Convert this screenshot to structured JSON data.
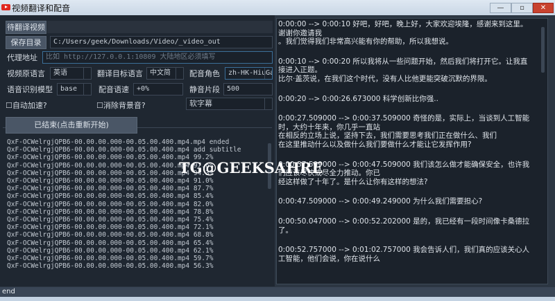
{
  "window": {
    "title": "视频翻译和配音",
    "minimize": "—",
    "maximize": "▫",
    "close": "✕"
  },
  "form": {
    "video_button": "待翻译视频",
    "video_path": "",
    "save_button": "保存目录",
    "save_path": "C:/Users/geek/Downloads/Video/_video_out",
    "proxy_label": "代理地址",
    "proxy_placeholder": "比如 http://127.0.0.1:10809 大陆地区必须填写",
    "source_lang_label": "视频原语言",
    "source_lang": "英语",
    "target_lang_label": "翻译目标语言",
    "target_lang": "中文简",
    "voice_label": "配音角色",
    "voice": "zh-HK-HiuGa",
    "model_label": "语音识别模型",
    "model": "base",
    "rate_label": "配音语速",
    "rate": "+0%",
    "silence_label": "静音片段",
    "silence": "500",
    "auto_speed_label": "自动加速?",
    "auto_speed": false,
    "remove_bg_label": "消除背景音?",
    "remove_bg": false,
    "subtitle_mode": "软字幕",
    "start_button": "已结束(点击重新开始)"
  },
  "log": [
    "QxF-OCWelrgjQPB6-00.00.00.000-00.05.00.400.mp4.mp4 ended",
    "QxF-OCWelrgjQPB6-00.00.00.000-00.05.00.400.mp4 add subtitle",
    "QxF-OCWelrgjQPB6-00.00.00.000-00.05.00.400.mp4 99.2%",
    "QxF-OCWelrgjQPB6-00.00.00.000-00.05.00.400.mp4 97.6%",
    "QxF-OCWelrgjQPB6-00.00.00.000-00.05.00.400.mp4 94.3%",
    "QxF-OCWelrgjQPB6-00.00.00.000-00.05.00.400.mp4 91.0%",
    "QxF-OCWelrgjQPB6-00.00.00.000-00.05.00.400.mp4 87.7%",
    "QxF-OCWelrgjQPB6-00.00.00.000-00.05.00.400.mp4 85.4%",
    "QxF-OCWelrgjQPB6-00.00.00.000-00.05.00.400.mp4 82.0%",
    "QxF-OCWelrgjQPB6-00.00.00.000-00.05.00.400.mp4 78.8%",
    "QxF-OCWelrgjQPB6-00.00.00.000-00.05.00.400.mp4 75.4%",
    "QxF-OCWelrgjQPB6-00.00.00.000-00.05.00.400.mp4 72.1%",
    "QxF-OCWelrgjQPB6-00.00.00.000-00.05.00.400.mp4 68.8%",
    "QxF-OCWelrgjQPB6-00.00.00.000-00.05.00.400.mp4 65.4%",
    "QxF-OCWelrgjQPB6-00.00.00.000-00.05.00.400.mp4 62.1%",
    "QxF-OCWelrgjQPB6-00.00.00.000-00.05.00.400.mp4 59.7%",
    "QxF-OCWelrgjQPB6-00.00.00.000-00.05.00.400.mp4 56.3%"
  ],
  "subtitles": [
    "0:00:00 --> 0:00:10 好吧，好吧，晚上好，大家欢迎埃隆，感谢来到这里。谢谢你邀请我\n。我们觉得我们非常高兴能有你的帮助，所以我想说。",
    "0:00:10 --> 0:00:20 所以我将从一些问题开始，然后我们将打开它。让我直接进入正题。\n比尔·盖茨说，在我们这个时代，没有人比他更能突破沉默的界限。",
    "0:00:20 --> 0:00:26.673000 科学创新比你强..",
    "0:00:27.509000 --> 0:00:37.509000 奇怪的是，实际上，当谈到人工智能时，大约十年来，你几乎一直站\n在相反的立场上说，坚持下去，我们需要思考我们正在做什么、我们\n在这里推动什么以及做什么我们要做什么才能让它发挥作用?",
    "0:00:37.509000 --> 0:00:47.509000 我们该怎么做才能确保安全，也许我们应该尽快或尽全力推动。你已\n经这样做了十年了。是什么让你有这样的想法?",
    "0:00:47.509000 --> 0:00:49.249000 为什么我们需要担心?",
    "0:00:50.047000 --> 0:00:52.202000 是的，我已经有一段时间像卡桑德拉了。",
    "0:00:52.757000 --> 0:01:02.757000 我会告诉人们，我们真的应该关心人工智能，他们会说，你在说什么"
  ],
  "status": "end",
  "watermark": "TG@GEEKSAHRE"
}
